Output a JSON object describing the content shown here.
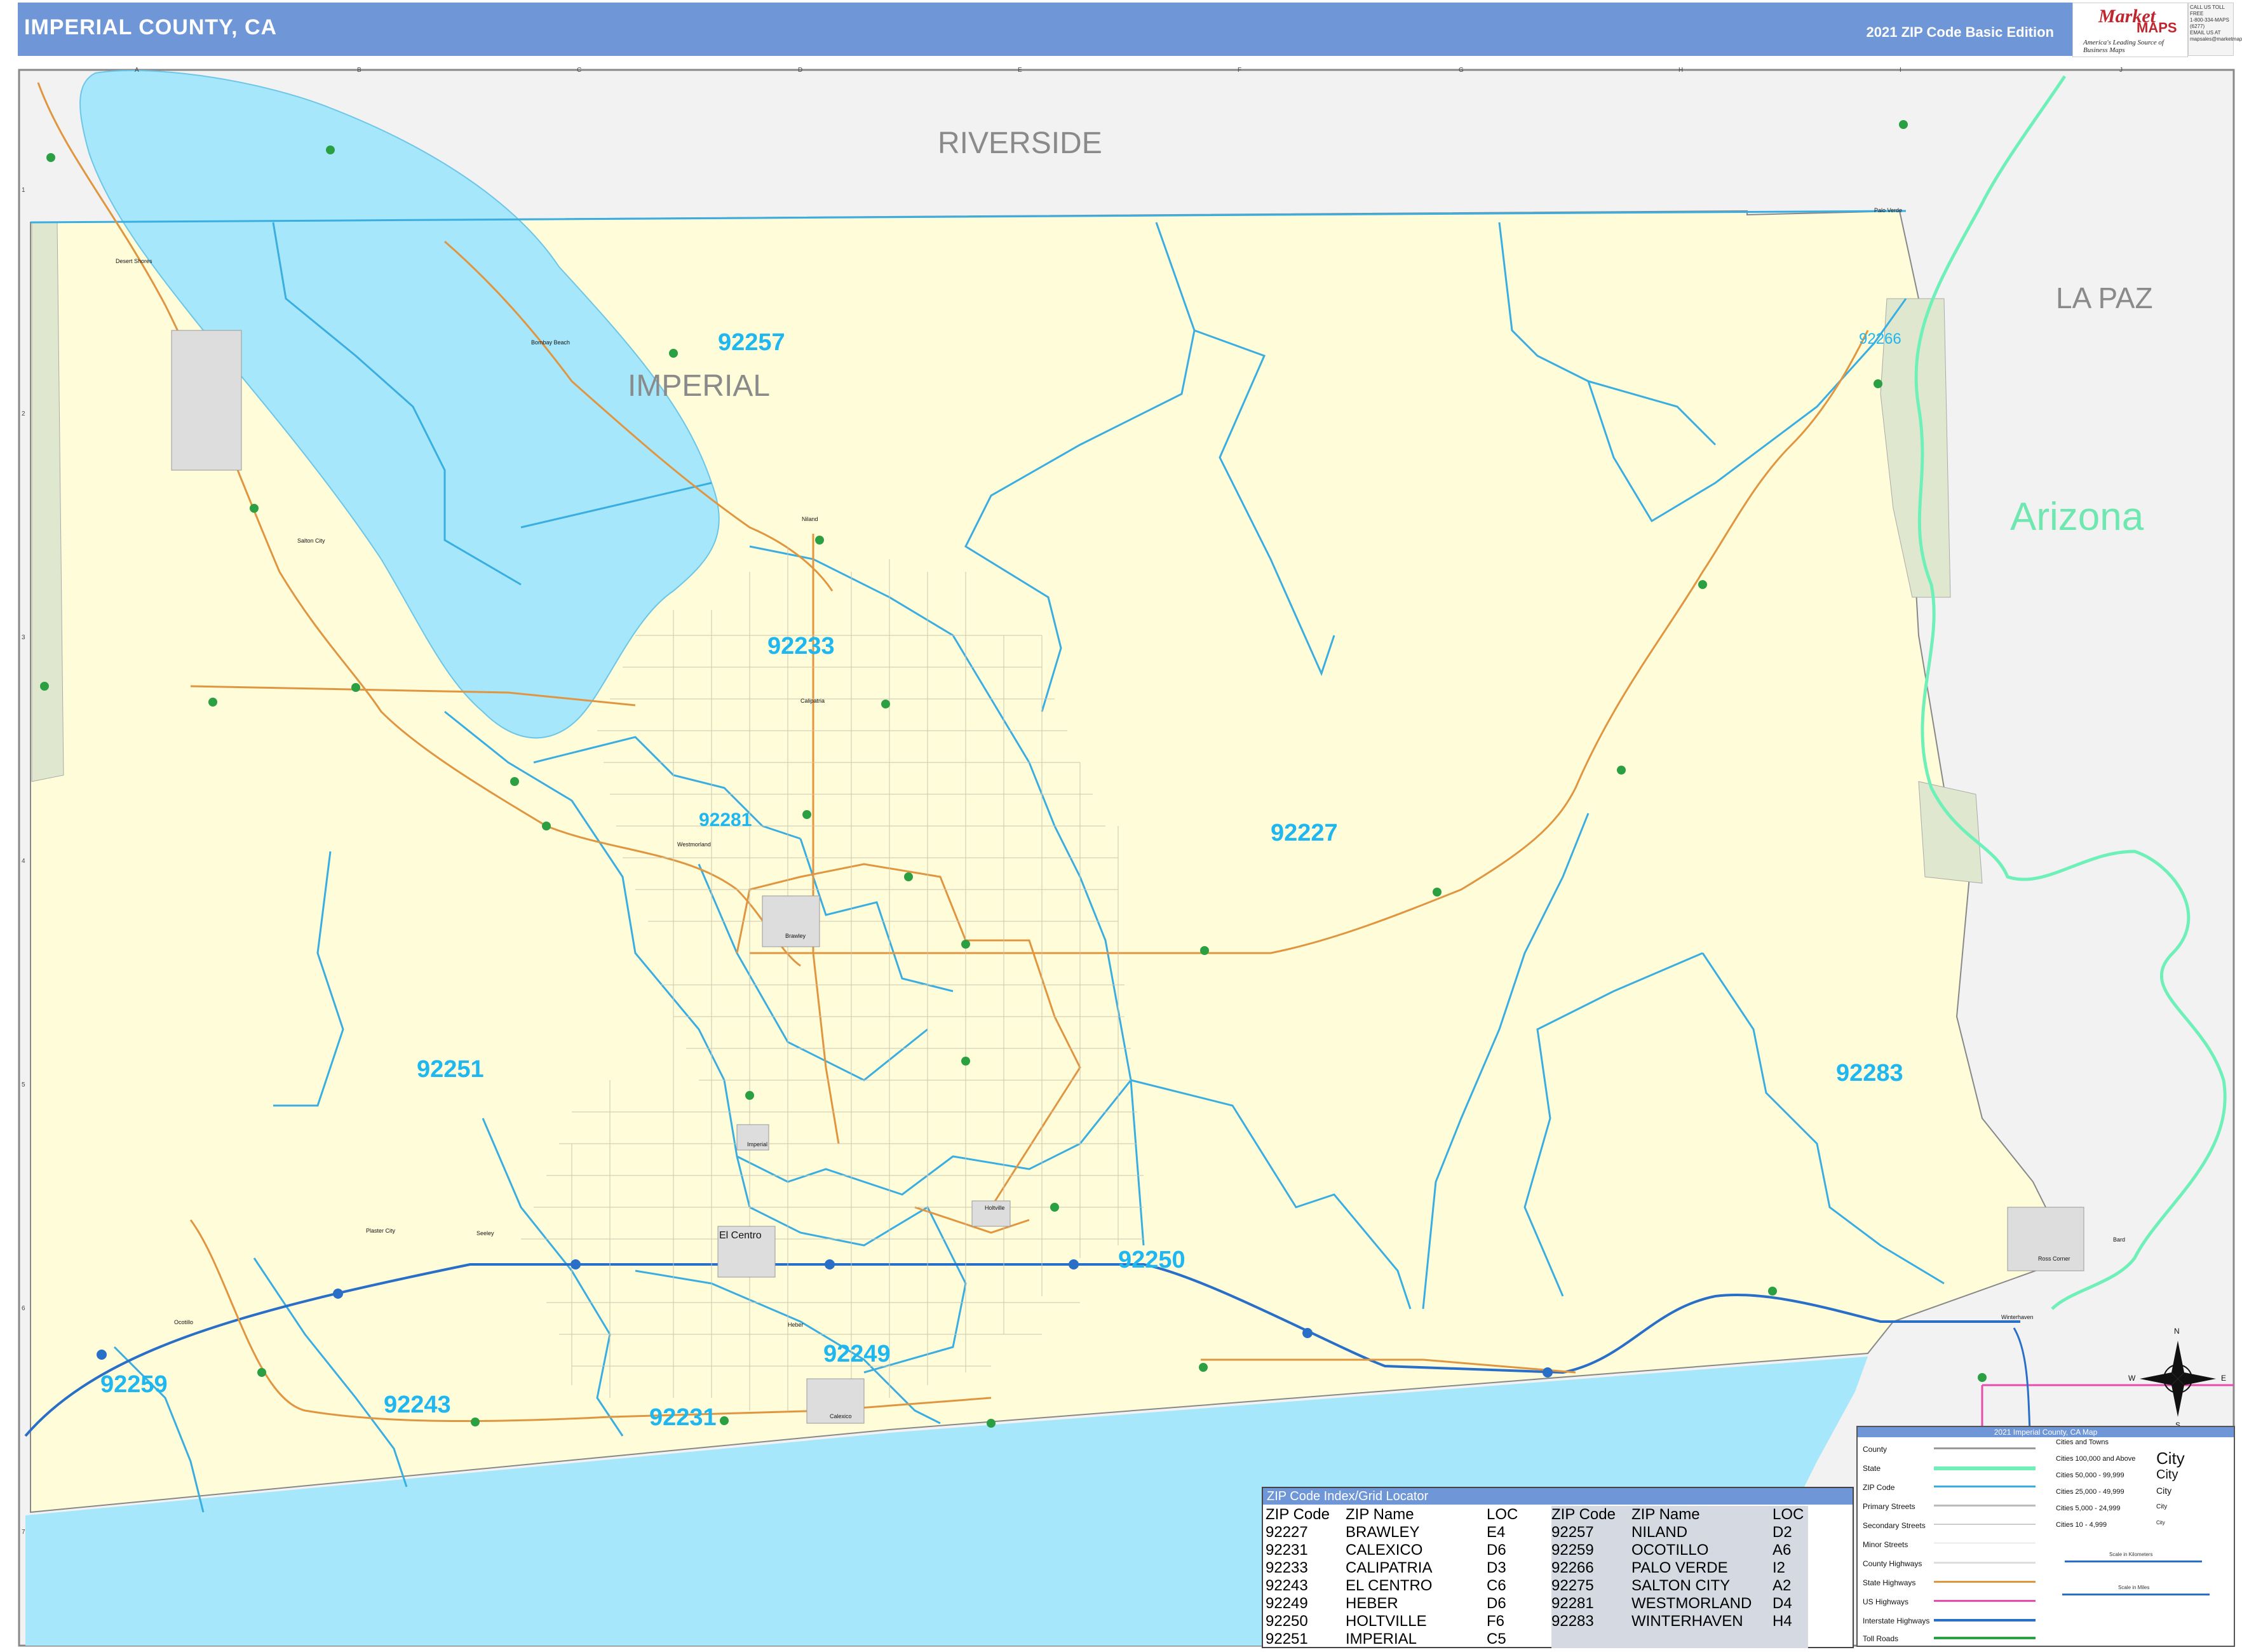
{
  "header": {
    "title": "IMPERIAL COUNTY, CA",
    "edition": "2021 ZIP Code Basic Edition"
  },
  "logo": {
    "brand_a": "Market",
    "brand_b": "MAPS",
    "tagline": "America's Leading Source of Business Maps"
  },
  "contact": {
    "line1": "CALL US TOLL FREE",
    "line2": "1-800-334-MAPS (6277)",
    "line3": "EMAIL US AT",
    "line4": "mapsales@marketmaps.com"
  },
  "grid": {
    "columns": [
      "A",
      "B",
      "C",
      "D",
      "E",
      "F",
      "G",
      "H",
      "I",
      "J"
    ],
    "rows": [
      "1",
      "2",
      "3",
      "4",
      "5",
      "6",
      "7"
    ]
  },
  "region_labels": {
    "riverside": "RIVERSIDE",
    "imperial": "IMPERIAL",
    "la_paz": "LA PAZ",
    "arizona": "Arizona"
  },
  "zip_labels": [
    "92257",
    "92266",
    "92233",
    "92281",
    "92227",
    "92251",
    "92283",
    "92250",
    "92249",
    "92259",
    "92243",
    "92231"
  ],
  "cities": {
    "el_centro": "El Centro",
    "brawley": "Brawley",
    "calexico": "Calexico",
    "calipatria": "Calipatria",
    "westmorland": "Westmorland",
    "imperial": "Imperial",
    "holtville": "Holtville",
    "niland": "Niland",
    "salton_city": "Salton City",
    "bombay_beach": "Bombay Beach",
    "desert_shores": "Desert Shores",
    "ocotillo": "Ocotillo",
    "plaster_city": "Plaster City",
    "seeley": "Seeley",
    "heber": "Heber",
    "palo_verde": "Palo Verde",
    "winterhaven": "Winterhaven",
    "bard": "Bard",
    "ross_corner": "Ross Corner"
  },
  "zip_index": {
    "title": "ZIP Code Index/Grid Locator",
    "headers": [
      "ZIP Code",
      "ZIP Name",
      "LOC",
      "ZIP Code",
      "ZIP Name",
      "LOC"
    ],
    "left": [
      [
        "92227",
        "BRAWLEY",
        "E4"
      ],
      [
        "92231",
        "CALEXICO",
        "D6"
      ],
      [
        "92233",
        "CALIPATRIA",
        "D3"
      ],
      [
        "92243",
        "EL CENTRO",
        "C6"
      ],
      [
        "92249",
        "HEBER",
        "D6"
      ],
      [
        "92250",
        "HOLTVILLE",
        "F6"
      ],
      [
        "92251",
        "IMPERIAL",
        "C5"
      ]
    ],
    "right": [
      [
        "92257",
        "NILAND",
        "D2"
      ],
      [
        "92259",
        "OCOTILLO",
        "A6"
      ],
      [
        "92266",
        "PALO VERDE",
        "I2"
      ],
      [
        "92275",
        "SALTON CITY",
        "A2"
      ],
      [
        "92281",
        "WESTMORLAND",
        "D4"
      ],
      [
        "92283",
        "WINTERHAVEN",
        "H4"
      ]
    ]
  },
  "legend": {
    "title": "2021 Imperial County, CA Map",
    "items": [
      "County",
      "State",
      "ZIP Code",
      "Primary Streets",
      "Secondary Streets",
      "Minor Streets",
      "County Highways",
      "State Highways",
      "US Highways",
      "Interstate Highways",
      "Toll Roads"
    ],
    "cities_title": "Cities and Towns",
    "city_classes": [
      "Cities 100,000 and Above",
      "Cities 50,000 - 99,999",
      "Cities 25,000 - 49,999",
      "Cities 5,000 - 24,999",
      "Cities 10 - 4,999"
    ],
    "city_sample": "City",
    "scale_km": "Scale in Kilometers",
    "scale_mi": "Scale in Miles"
  },
  "compass": {
    "n": "N",
    "s": "S",
    "e": "E",
    "w": "W"
  },
  "colors": {
    "land": "#fffcda",
    "outside": "#f2f2f2",
    "water": "#a6e7fb",
    "zip_boundary": "#3aaee0",
    "zip_label": "#1fb7f0",
    "state_line": "#6ff0b8",
    "highway": "#e09640",
    "interstate": "#2a6fc7",
    "header": "#6f97d8"
  }
}
